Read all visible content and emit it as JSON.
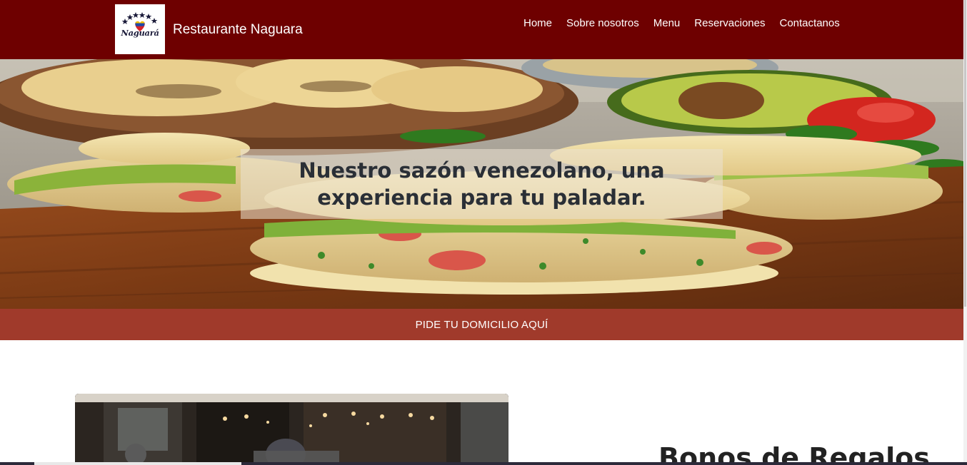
{
  "brand": {
    "name": "Restaurante Naguara",
    "logo_text": "Naguará",
    "logo_icon": "venezuela-stars-heart-logo"
  },
  "nav": {
    "items": [
      {
        "label": "Home"
      },
      {
        "label": "Sobre nosotros"
      },
      {
        "label": "Menu"
      },
      {
        "label": "Reservaciones"
      },
      {
        "label": "Contactanos"
      }
    ]
  },
  "hero": {
    "caption": "Nuestro sazón venezolano, una experiencia para tu paladar.",
    "image": "arepas-reina-pepiada-photo"
  },
  "order_bar": {
    "label": "PIDE TU DOMICILIO AQUÍ"
  },
  "content": {
    "photo": "restaurant-interior-photo",
    "section_title": "Bonos de Regalos"
  },
  "colors": {
    "navbar": "#6e0000",
    "order_bar": "#a03a2b",
    "text_dark": "#222222",
    "white": "#ffffff"
  }
}
